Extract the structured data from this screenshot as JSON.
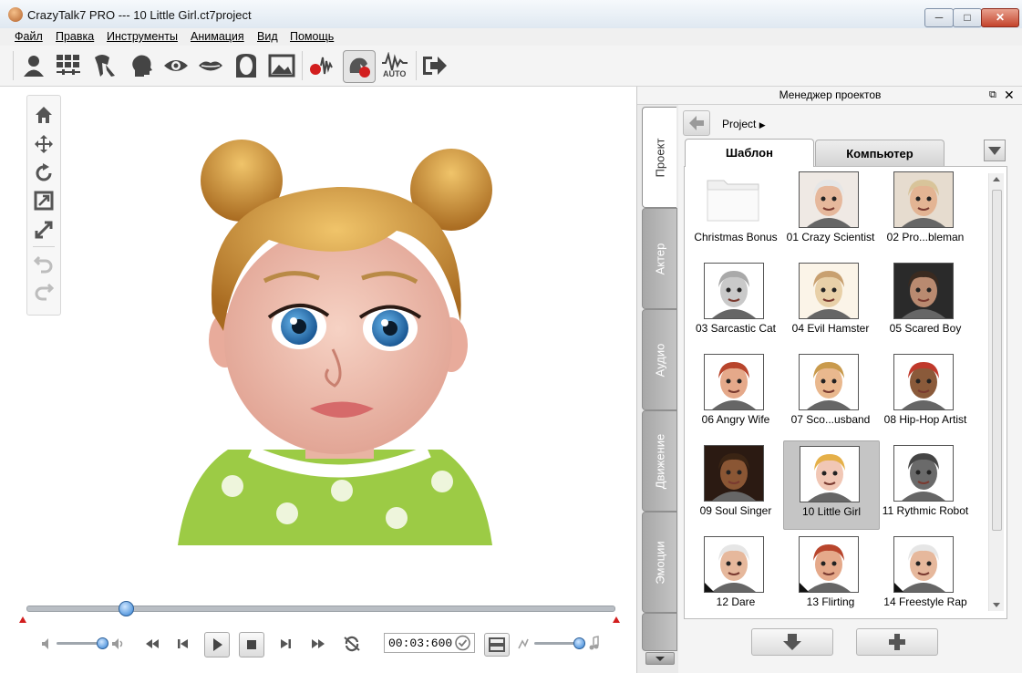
{
  "window": {
    "title": "CrazyTalk7 PRO --- 10 Little Girl.ct7project",
    "min_icon": "minimize-icon",
    "max_icon": "maximize-icon",
    "close_icon": "close-icon"
  },
  "menu": [
    "Файл",
    "Правка",
    "Инструменты",
    "Анимация",
    "Вид",
    "Помощь"
  ],
  "toolbar": {
    "icons": [
      "actor-icon",
      "scene-icon",
      "face-fitting-icon",
      "head-icon",
      "eye-icon",
      "mouth-icon",
      "face-mask-icon",
      "background-image-icon",
      "record-voice-icon",
      "puppet-record-icon",
      "auto-lipsync-icon",
      "export-icon"
    ],
    "auto_label": "AUTO"
  },
  "playback": {
    "timecode": "00:03:600",
    "timeline_position": 0.17,
    "volume_level": 0.8,
    "speed_level": 0.85
  },
  "panel": {
    "title": "Менеджер проектов",
    "vertical_tabs": [
      "Проект",
      "Актер",
      "Аудио",
      "Движение",
      "Эмоции"
    ],
    "breadcrumb": "Project",
    "tab_template": "Шаблон",
    "tab_computer": "Компьютер",
    "items": [
      "Christmas Bonus",
      "01 Crazy Scientist",
      "02 Pro...bleman",
      "03 Sarcastic Cat",
      "04 Evil Hamster",
      "05 Scared Boy",
      "06 Angry Wife",
      "07 Sco...usband",
      "08 Hip-Hop Artist",
      "09 Soul Singer",
      "10 Little Girl",
      "11 Rythmic Robot",
      "12 Dare",
      "13 Flirting",
      "14 Freestyle Rap"
    ],
    "selected_item": "10 Little Girl"
  },
  "colors": {
    "accent_blue": "#2f7fd3",
    "record_red": "#d21e1e",
    "panel_bg": "#eaeaea"
  }
}
